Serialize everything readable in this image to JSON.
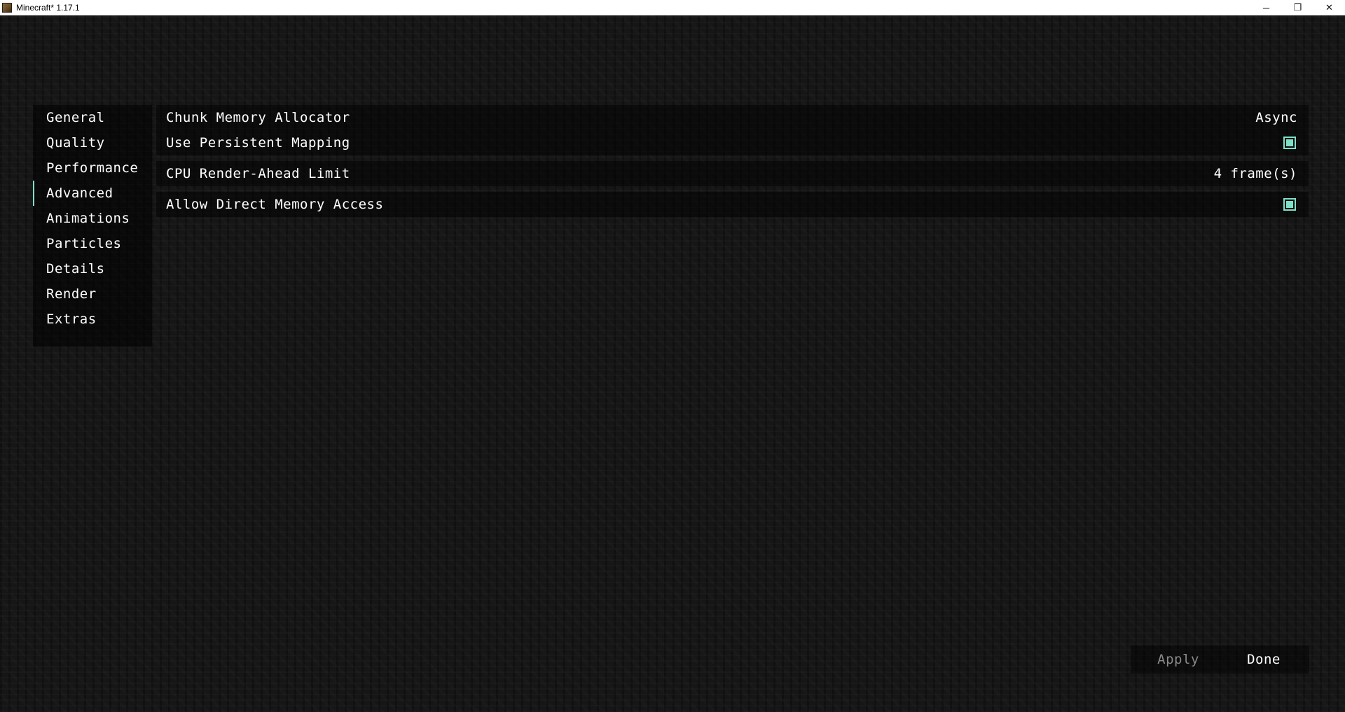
{
  "window": {
    "title": "Minecraft* 1.17.1",
    "minimize": "─",
    "restore": "❐",
    "close": "✕"
  },
  "sidebar": {
    "items": [
      {
        "label": "General"
      },
      {
        "label": "Quality"
      },
      {
        "label": "Performance"
      },
      {
        "label": "Advanced",
        "active": true
      },
      {
        "label": "Animations"
      },
      {
        "label": "Particles"
      },
      {
        "label": "Details"
      },
      {
        "label": "Render"
      },
      {
        "label": "Extras"
      }
    ]
  },
  "options": [
    {
      "label": "Chunk Memory Allocator",
      "value": "Async",
      "type": "cycle"
    },
    {
      "label": "Use Persistent Mapping",
      "checked": true,
      "type": "checkbox"
    },
    {
      "label": "CPU Render-Ahead Limit",
      "value": "4 frame(s)",
      "type": "slider"
    },
    {
      "label": "Allow Direct Memory Access",
      "checked": true,
      "type": "checkbox"
    }
  ],
  "footer": {
    "apply_label": "Apply",
    "done_label": "Done"
  },
  "colors": {
    "accent": "#7fe0c8",
    "disabled_text": "#8a8a8a",
    "text": "#ffffff"
  }
}
